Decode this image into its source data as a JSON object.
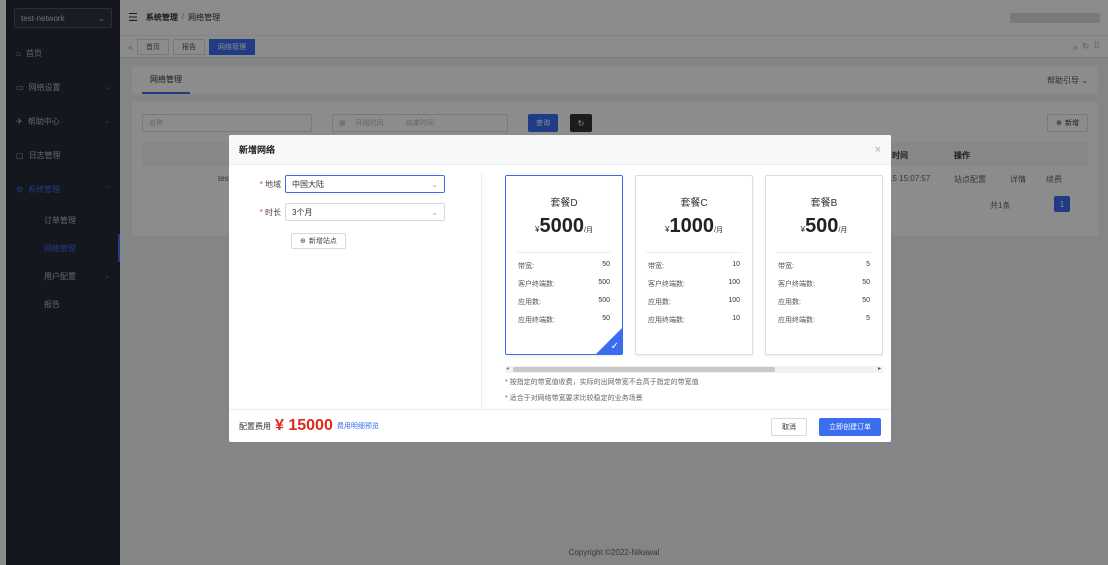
{
  "sidebar": {
    "network_select": "test-network",
    "items": [
      {
        "label": "首页"
      },
      {
        "label": "网络设置"
      },
      {
        "label": "帮助中心"
      },
      {
        "label": "日志管理"
      },
      {
        "label": "系统管理"
      }
    ],
    "sub_items": [
      {
        "label": "订单管理"
      },
      {
        "label": "网络管理"
      },
      {
        "label": "用户配置"
      },
      {
        "label": "报告"
      }
    ]
  },
  "header": {
    "breadcrumb_root": "系统管理",
    "breadcrumb_sep": "/",
    "breadcrumb_current": "网络管理"
  },
  "tabs": [
    {
      "label": "首页"
    },
    {
      "label": "报告"
    },
    {
      "label": "网络管理"
    }
  ],
  "page": {
    "tab_label": "网络管理",
    "help": "帮助引导",
    "search_placeholder": "名称",
    "start_time": "开始时间",
    "range_sep": "-",
    "end_time": "结束时间",
    "query_button": "查询",
    "new_button": "新增",
    "col_time": "时间",
    "col_ops": "操作",
    "row_name": "test",
    "row_time": "15 15:07:57",
    "op_site": "站点配置",
    "op_detail": "详情",
    "op_renew": "续费",
    "total": "共1条",
    "page_num": "1"
  },
  "modal": {
    "title": "新增网络",
    "region_label": "地域",
    "region_value": "中国大陆",
    "duration_label": "时长",
    "duration_value": "3个月",
    "add_site": "新增站点",
    "packages": [
      {
        "name": "套餐D",
        "currency": "¥",
        "price": "5000",
        "unit": "/月",
        "bandwidth": "50",
        "clients": "500",
        "apps": "500",
        "app_terminals": "50",
        "selected": true
      },
      {
        "name": "套餐C",
        "currency": "¥",
        "price": "1000",
        "unit": "/月",
        "bandwidth": "10",
        "clients": "100",
        "apps": "100",
        "app_terminals": "10",
        "selected": false
      },
      {
        "name": "套餐B",
        "currency": "¥",
        "price": "500",
        "unit": "/月",
        "bandwidth": "5",
        "clients": "50",
        "apps": "50",
        "app_terminals": "5",
        "selected": false
      }
    ],
    "row_labels": {
      "bandwidth": "带宽:",
      "clients": "客户终端数:",
      "apps": "应用数:",
      "app_terminals": "应用终端数:"
    },
    "note1": "* 按指定的带宽值收费，实际的出网带宽不会高于指定的带宽值",
    "note2": "* 适合于对网络带宽要求比较稳定的业务场景",
    "fee_label": "配置费用",
    "fee_value": "¥ 15000",
    "fee_link": "费用明细预览",
    "cancel": "取消",
    "create": "立即创建订单"
  },
  "footer": {
    "copyright": "Copyright ©2022-Nikawal"
  },
  "colors": {
    "accent": "#3b6df0",
    "sidebar_bg": "#262b36",
    "price_red": "#e0281b"
  }
}
